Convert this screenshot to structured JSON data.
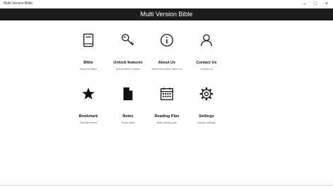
{
  "window": {
    "title": "Multi Version Bible",
    "controls": {
      "minimize": "–",
      "maximize": "□",
      "close": "×"
    }
  },
  "header": {
    "title": "Multi Version Bible",
    "background": "#1b1b1b"
  },
  "tiles": [
    {
      "label": "Bible",
      "sub": "Study the Bible",
      "icon": "book-icon"
    },
    {
      "label": "Unlock features",
      "sub": "Unlock Bible versions",
      "icon": "key-icon"
    },
    {
      "label": "About Us",
      "sub": "More information about us",
      "icon": "info-icon"
    },
    {
      "label": "Contact Us",
      "sub": "Contact us",
      "icon": "person-icon"
    },
    {
      "label": "Bookmark",
      "sub": "Favorite verses",
      "icon": "star-icon"
    },
    {
      "label": "Notes",
      "sub": "Study notes",
      "icon": "note-icon"
    },
    {
      "label": "Reading Plan",
      "sub": "Bible reading plan",
      "icon": "calendar-icon"
    },
    {
      "label": "Settings",
      "sub": "System settings",
      "icon": "gear-icon"
    }
  ]
}
